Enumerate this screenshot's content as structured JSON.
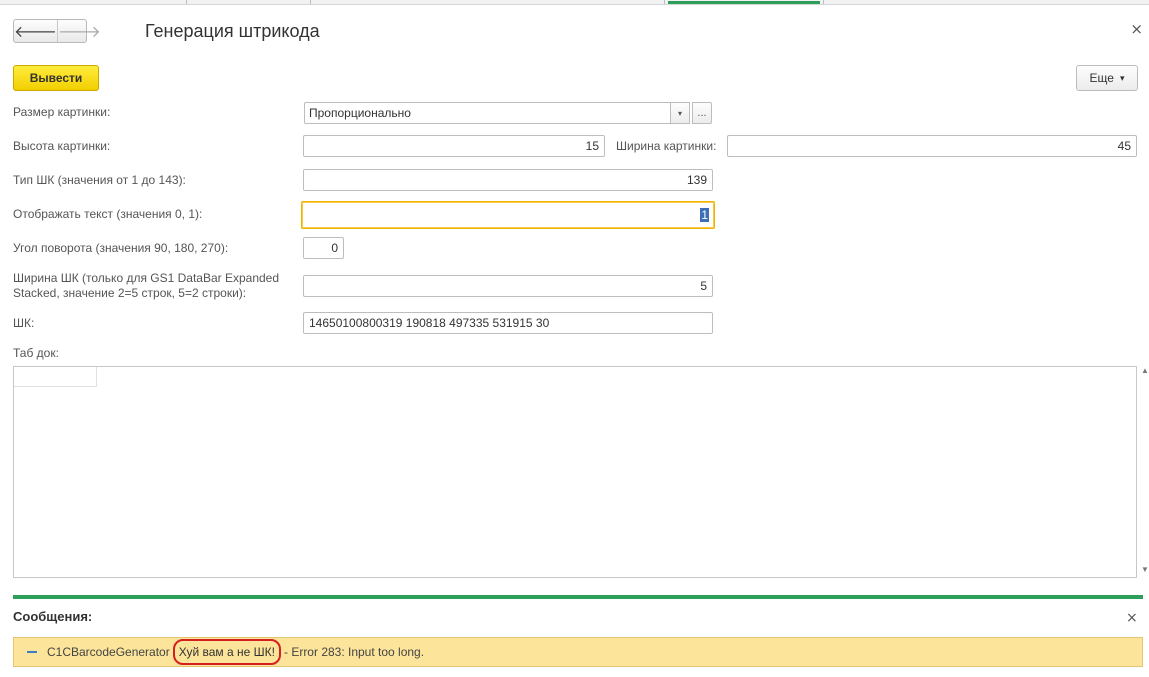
{
  "window": {
    "title": "Генерация штрикода",
    "back_icon": "arrow-left-icon",
    "forward_icon": "arrow-right-icon",
    "close_glyph": "×"
  },
  "toolbar": {
    "primary_label": "Вывести",
    "more_label": "Еще",
    "more_caret": "▾",
    "primary_color": "#f5d300"
  },
  "form": {
    "image_size": {
      "label": "Размер картинки:",
      "value": "Пропорционально",
      "dropdown_glyph": "▾",
      "choose_glyph": "..."
    },
    "image_height": {
      "label": "Высота картинки:",
      "value": "15"
    },
    "image_width": {
      "label": "Ширина картинки:",
      "value": "45"
    },
    "barcode_type": {
      "label": "Тип ШК (значения от 1 до 143):",
      "value": "139"
    },
    "show_text": {
      "label": "Отображать текст (значения 0, 1):",
      "value": "1"
    },
    "rotation": {
      "label": "Угол поворота (значения 90, 180, 270):",
      "value": "0"
    },
    "barcode_width": {
      "label_line1": "Ширина ШК (только для GS1 DataBar Expanded",
      "label_line2": "Stacked, значение 2=5 строк, 5=2 строки):",
      "value": "5"
    },
    "barcode": {
      "label": "ШК:",
      "value": "14650100800319 190818 497335 531915 30"
    },
    "tab_doc": {
      "label": "Таб док:"
    }
  },
  "messages": {
    "title": "Сообщения:",
    "close_glyph": "×",
    "items": [
      {
        "source": "C1CBarcodeGenerator",
        "highlighted": "Хуй вам а не ШК!",
        "text": "- Error 283: Input too long."
      }
    ],
    "row_color": "#fce49a",
    "accent_color": "#2e9e5b"
  },
  "scroll": {
    "up_glyph": "▲",
    "down_glyph": "▼"
  }
}
